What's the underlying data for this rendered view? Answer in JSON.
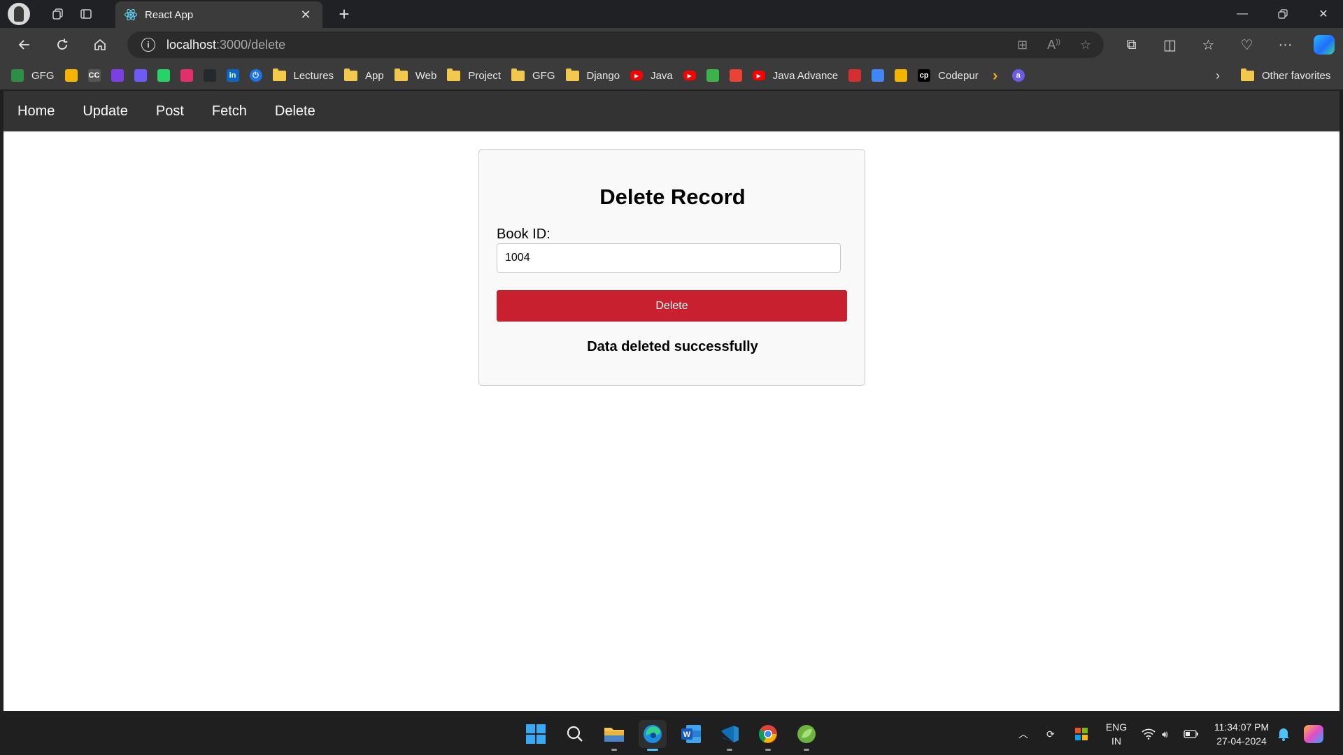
{
  "browser": {
    "tab_title": "React App",
    "url_host": "localhost",
    "url_path": ":3000/delete",
    "favorites": [
      {
        "label": "GFG",
        "icon": "gfg-icon",
        "color": "#2f8d46"
      },
      {
        "label": "",
        "icon": "bar-chart-icon",
        "color": "#f4b400"
      },
      {
        "label": "",
        "icon": "cc-icon",
        "color": "#555555"
      },
      {
        "label": "",
        "icon": "bolt-icon",
        "color": "#7b3fe4"
      },
      {
        "label": "",
        "icon": "cloud-icon",
        "color": "#6f5af6"
      },
      {
        "label": "",
        "icon": "whatsapp-icon",
        "color": "#25d366"
      },
      {
        "label": "",
        "icon": "instagram-icon",
        "color": "#e1306c"
      },
      {
        "label": "",
        "icon": "github-icon",
        "color": "#24292e"
      },
      {
        "label": "",
        "icon": "linkedin-icon",
        "color": "#0a66c2"
      },
      {
        "label": "",
        "icon": "power-icon",
        "color": "#1a73e8"
      },
      {
        "label": "Lectures",
        "icon": "folder-icon"
      },
      {
        "label": "App",
        "icon": "folder-icon"
      },
      {
        "label": "Web",
        "icon": "folder-icon"
      },
      {
        "label": "Project",
        "icon": "folder-icon"
      },
      {
        "label": "GFG",
        "icon": "folder-icon"
      },
      {
        "label": "Django",
        "icon": "folder-icon"
      },
      {
        "label": "Java",
        "icon": "youtube-icon",
        "color": "#ff0000"
      },
      {
        "label": "",
        "icon": "youtube-icon",
        "color": "#ff0000"
      },
      {
        "label": "",
        "icon": "leaf-icon",
        "color": "#3bb34a"
      },
      {
        "label": "",
        "icon": "gmail-icon",
        "color": "#ea4335"
      },
      {
        "label": "Java Advance",
        "icon": "youtube-icon",
        "color": "#ff0000"
      },
      {
        "label": "",
        "icon": "bank-icon",
        "color": "#d32f2f"
      },
      {
        "label": "",
        "icon": "docs-icon",
        "color": "#4285f4"
      },
      {
        "label": "",
        "icon": "bar-chart-icon",
        "color": "#f4b400"
      },
      {
        "label": "Codepur",
        "icon": "codepen-icon",
        "color": "#000000"
      },
      {
        "label": "",
        "icon": "chevron-right-icon",
        "color": "#f5a623"
      },
      {
        "label": "",
        "icon": "at-icon",
        "color": "#6c5ce7"
      }
    ],
    "other_favorites": "Other favorites"
  },
  "app": {
    "nav": [
      "Home",
      "Update",
      "Post",
      "Fetch",
      "Delete"
    ],
    "card": {
      "title": "Delete Record",
      "field_label": "Book ID:",
      "field_value": "1004",
      "button_label": "Delete",
      "status": "Data deleted successfully",
      "button_color": "#c8202e"
    }
  },
  "taskbar": {
    "language": "ENG",
    "region": "IN",
    "time": "11:34:07 PM",
    "date": "27-04-2024"
  }
}
